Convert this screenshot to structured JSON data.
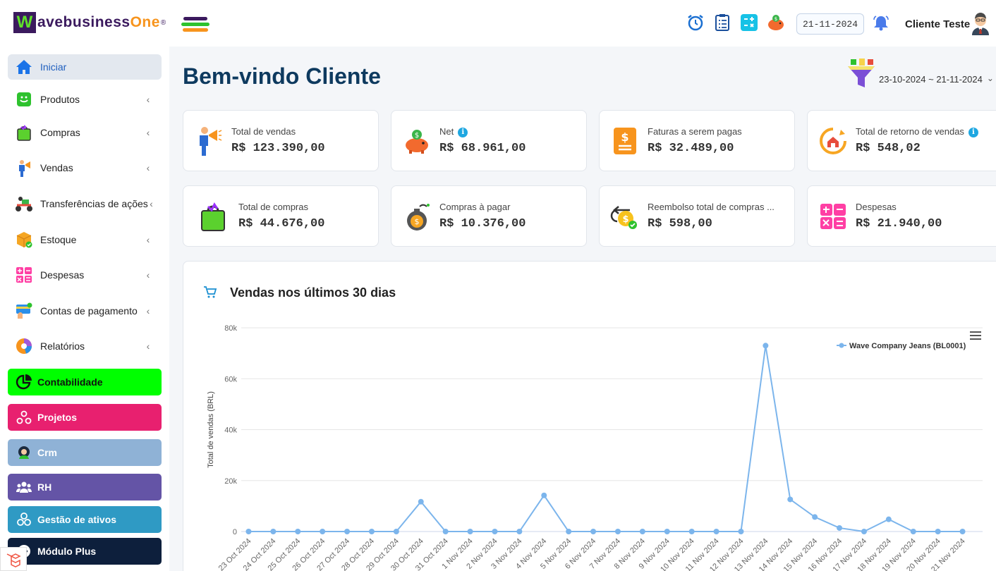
{
  "header": {
    "logo_letter": "W",
    "logo_text_pre": "avebusiness",
    "logo_text_o": "One",
    "logo_reg": "®",
    "date": "21-11-2024",
    "user_name": "Cliente Teste"
  },
  "sidebar": {
    "items": [
      {
        "label": "Iniciar",
        "icon": "home-icon",
        "expandable": false
      },
      {
        "label": "Produtos",
        "icon": "box-smile-icon",
        "expandable": true
      },
      {
        "label": "Compras",
        "icon": "shopping-bag-icon",
        "expandable": true
      },
      {
        "label": "Vendas",
        "icon": "salesman-icon",
        "expandable": true
      },
      {
        "label": "Transferências de ações",
        "icon": "delivery-icon",
        "expandable": true
      },
      {
        "label": "Estoque",
        "icon": "package-icon",
        "expandable": true
      },
      {
        "label": "Despesas",
        "icon": "calculator-icon",
        "expandable": true
      },
      {
        "label": "Contas de pagamento",
        "icon": "card-icon",
        "expandable": true
      },
      {
        "label": "Relatórios",
        "icon": "pie-chart-icon",
        "expandable": true
      }
    ],
    "modules": [
      {
        "label": "Contabilidade",
        "color": "#00ff00",
        "icon": "pie-icon"
      },
      {
        "label": "Projetos",
        "color": "#e8206f",
        "icon": "nodes-icon"
      },
      {
        "label": "Crm",
        "color": "#8fb2d6",
        "icon": "headset-icon"
      },
      {
        "label": "RH",
        "color": "#6454a6",
        "icon": "users-icon"
      },
      {
        "label": "Gestão de ativos",
        "color": "#2f9ac4",
        "icon": "assets-icon"
      },
      {
        "label": "Módulo Plus",
        "color": "#0d1f3c",
        "icon": "plus-icon"
      }
    ],
    "chevron": "‹"
  },
  "main": {
    "welcome": "Bem-vindo Cliente",
    "date_range": "23-10-2024 ~ 21-11-2024",
    "cards": [
      {
        "label": "Total de vendas",
        "value": "R$ 123.390,00",
        "icon": "megaphone-man-icon",
        "info": false
      },
      {
        "label": "Net",
        "value": "R$ 68.961,00",
        "icon": "piggy-bank-icon",
        "info": true
      },
      {
        "label": "Faturas a serem pagas",
        "value": "R$ 32.489,00",
        "icon": "invoice-icon",
        "info": false
      },
      {
        "label": "Total de retorno de vendas",
        "value": "R$ 548,02",
        "icon": "return-home-icon",
        "info": true
      },
      {
        "label": "Total de compras",
        "value": "R$ 44.676,00",
        "icon": "shopping-bag-icon",
        "info": false
      },
      {
        "label": "Compras à pagar",
        "value": "R$ 10.376,00",
        "icon": "money-bag-icon",
        "info": false
      },
      {
        "label": "Reembolso total de compras ...",
        "value": "R$ 598,00",
        "icon": "refund-coin-icon",
        "info": false
      },
      {
        "label": "Despesas",
        "value": "R$ 21.940,00",
        "icon": "calculator-icon",
        "info": false
      }
    ],
    "info_glyph": "i"
  },
  "chart_data": {
    "type": "line",
    "title": "Vendas nos últimos 30 dias",
    "ylabel": "Total de vendas (BRL)",
    "xlabel": "",
    "ylim": [
      0,
      80000
    ],
    "yticks": [
      "0",
      "20k",
      "40k",
      "60k",
      "80k"
    ],
    "ytick_values": [
      0,
      20000,
      40000,
      60000,
      80000
    ],
    "grid": true,
    "legend": "top-right",
    "categories": [
      "23 Oct 2024",
      "24 Oct 2024",
      "25 Oct 2024",
      "26 Oct 2024",
      "27 Oct 2024",
      "28 Oct 2024",
      "29 Oct 2024",
      "30 Oct 2024",
      "31 Oct 2024",
      "1 Nov 2024",
      "2 Nov 2024",
      "3 Nov 2024",
      "4 Nov 2024",
      "5 Nov 2024",
      "6 Nov 2024",
      "7 Nov 2024",
      "8 Nov 2024",
      "9 Nov 2024",
      "10 Nov 2024",
      "11 Nov 2024",
      "12 Nov 2024",
      "13 Nov 2024",
      "14 Nov 2024",
      "15 Nov 2024",
      "16 Nov 2024",
      "17 Nov 2024",
      "18 Nov 2024",
      "19 Nov 2024",
      "20 Nov 2024",
      "21 Nov 2024"
    ],
    "series": [
      {
        "name": "Wave Company Jeans (BL0001)",
        "color": "#7cb5ec",
        "values": [
          0,
          0,
          0,
          0,
          0,
          0,
          0,
          11700,
          0,
          0,
          0,
          0,
          14200,
          0,
          0,
          0,
          0,
          0,
          0,
          0,
          0,
          73000,
          12600,
          5700,
          1400,
          0,
          4800,
          0,
          0,
          0
        ]
      }
    ]
  }
}
